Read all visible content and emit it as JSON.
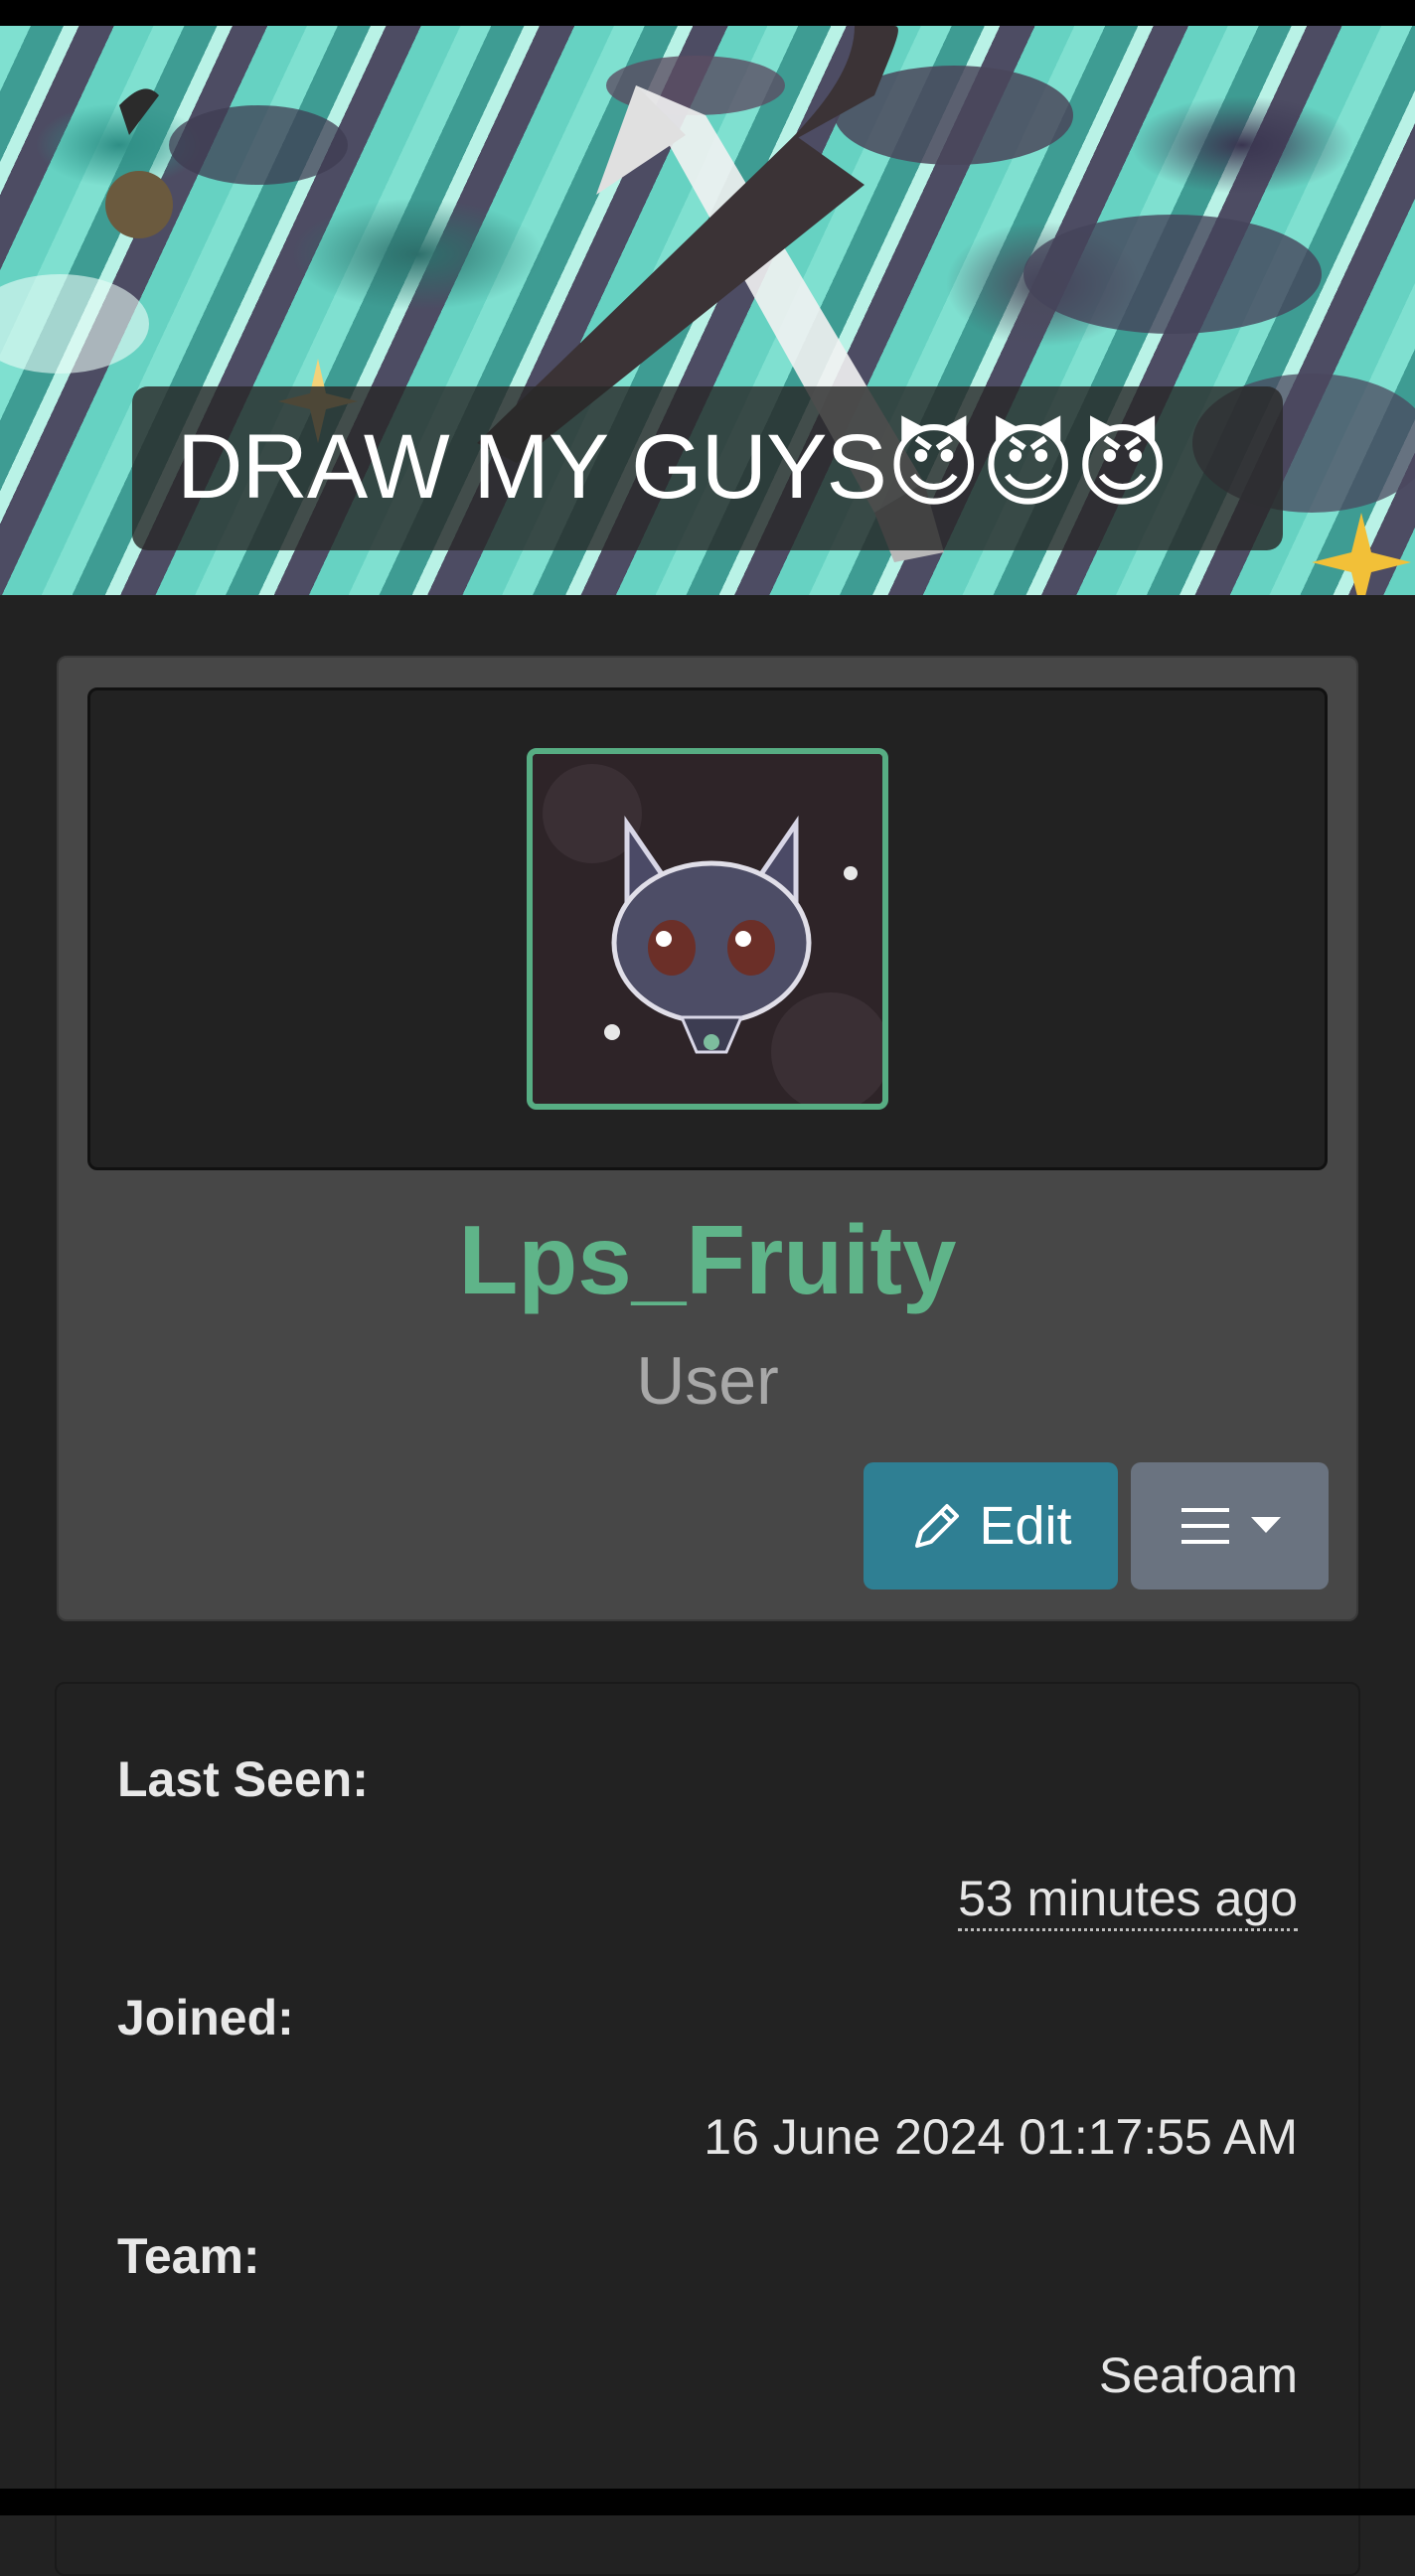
{
  "banner": {
    "title": "DRAW MY GUYS😈😈😈"
  },
  "profile": {
    "username": "Lps_Fruity",
    "role": "User",
    "edit_label": "Edit",
    "avatar_alt": "profile avatar"
  },
  "info": {
    "last_seen_label": "Last Seen:",
    "last_seen_value": "53 minutes ago",
    "joined_label": "Joined:",
    "joined_value": "16 June 2024 01:17:55 AM",
    "team_label": "Team:",
    "team_value": "Seafoam"
  },
  "colors": {
    "accent_green": "#5fb489",
    "edit_button": "#2f7f93",
    "menu_button": "#6a7380",
    "background": "#222222",
    "card": "#474747"
  }
}
